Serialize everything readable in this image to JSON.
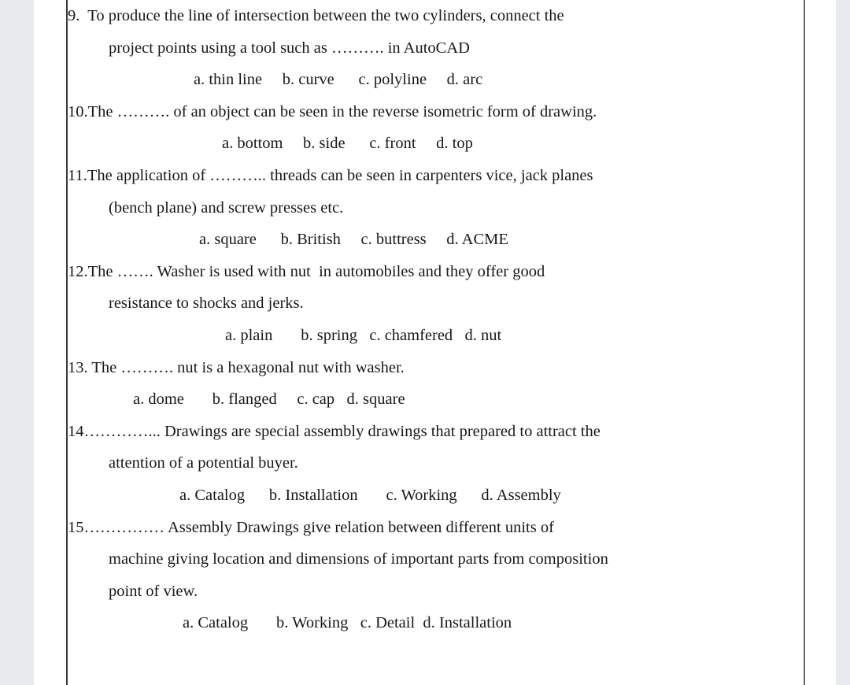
{
  "document": {
    "type": "scanned-exam-page",
    "page_background": "#ffffff",
    "gutter_color": "#e8eaec",
    "rule_color": "#3a3a3a",
    "text_color": "#17181a"
  },
  "questions": [
    {
      "number": "9.",
      "lines": [
        "9.  To produce the line of intersection between the two cylinders, connect the",
        "project points using a tool such as ………. in AutoCAD"
      ],
      "options": [
        "a. thin line",
        "b. curve",
        "c. polyline",
        "d. arc"
      ],
      "options_text": "a. thin line     b. curve      c. polyline     d. arc"
    },
    {
      "number": "10.",
      "lines": [
        "10.The ………. of an object can be seen in the reverse isometric form of drawing."
      ],
      "options": [
        "a. bottom",
        "b. side",
        "c. front",
        "d. top"
      ],
      "options_text": "a. bottom     b. side      c. front     d. top"
    },
    {
      "number": "11.",
      "lines": [
        "11.The application of ……….. threads can be seen in carpenters vice, jack planes",
        "(bench plane) and screw presses etc."
      ],
      "options": [
        "a. square",
        "b. British",
        "c. buttress",
        "d. ACME"
      ],
      "options_text": "a. square      b. British     c. buttress     d. ACME"
    },
    {
      "number": "12.",
      "lines": [
        "12.The ……. Washer is used with nut  in automobiles and they offer good",
        "resistance to shocks and jerks."
      ],
      "options": [
        "a. plain",
        "b. spring",
        "c. chamfered",
        "d. nut"
      ],
      "options_text": "a. plain       b. spring   c. chamfered   d. nut"
    },
    {
      "number": "13.",
      "lines": [
        "13. The ………. nut is a hexagonal nut with washer."
      ],
      "options": [
        "a. dome",
        "b. flanged",
        "c. cap",
        "d. square"
      ],
      "options_text": "a. dome       b. flanged     c. cap   d. square"
    },
    {
      "number": "14.",
      "lines": [
        "14…………... Drawings are special assembly drawings that prepared to attract the",
        "attention of a potential buyer."
      ],
      "options": [
        "a. Catalog",
        "b. Installation",
        "c. Working",
        "d. Assembly"
      ],
      "options_text": "a. Catalog      b. Installation       c. Working      d. Assembly"
    },
    {
      "number": "15.",
      "lines": [
        "15…………… Assembly Drawings give relation between different units of",
        "machine giving location and dimensions of important parts from composition",
        "point of view."
      ],
      "options": [
        "a. Catalog",
        "b. Working",
        "c. Detail",
        "d. Installation"
      ],
      "options_text": "a. Catalog       b. Working   c. Detail  d. Installation"
    }
  ]
}
